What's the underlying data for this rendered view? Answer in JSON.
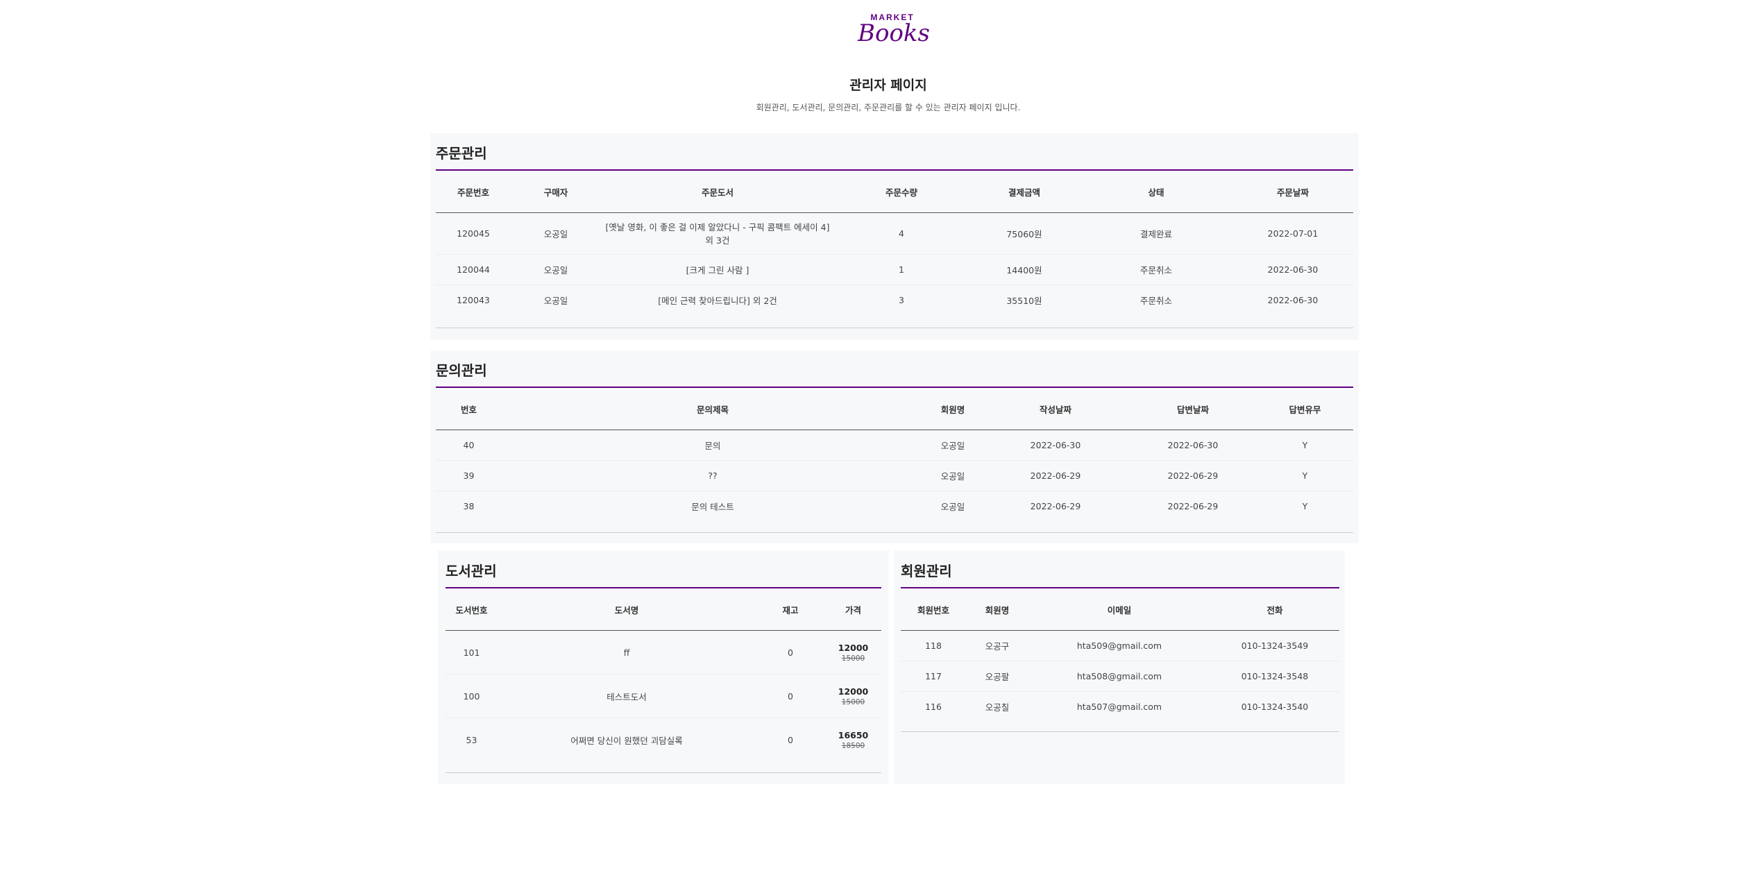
{
  "header": {
    "logo_top": "MARKET",
    "logo_main": "Books",
    "title": "관리자 페이지",
    "description": "회원관리, 도서관리, 문의관리, 주문관리를 할 수 있는 관리자 페이지 입니다."
  },
  "orders": {
    "title": "주문관리",
    "columns": [
      "주문번호",
      "구매자",
      "주문도서",
      "주문수량",
      "결제금액",
      "상태",
      "주문날짜"
    ],
    "rows": [
      [
        "120045",
        "오공일",
        "[옛날 영화, 이 좋은 걸 이제 알았다니 - 구픽 콤팩트 에세이 4] 외 3건",
        "4",
        "75060원",
        "결제완료",
        "2022-07-01"
      ],
      [
        "120044",
        "오공일",
        "[크게 그린 사람 ]",
        "1",
        "14400원",
        "주문취소",
        "2022-06-30"
      ],
      [
        "120043",
        "오공일",
        "[메인 근력 찾아드립니다] 외 2건",
        "3",
        "35510원",
        "주문취소",
        "2022-06-30"
      ]
    ]
  },
  "inquiries": {
    "title": "문의관리",
    "columns": [
      "번호",
      "문의제목",
      "회원명",
      "작성날짜",
      "답변날짜",
      "답변유무"
    ],
    "rows": [
      [
        "40",
        "문의",
        "오공일",
        "2022-06-30",
        "2022-06-30",
        "Y"
      ],
      [
        "39",
        "??",
        "오공일",
        "2022-06-29",
        "2022-06-29",
        "Y"
      ],
      [
        "38",
        "문의 테스트",
        "오공일",
        "2022-06-29",
        "2022-06-29",
        "Y"
      ]
    ]
  },
  "books": {
    "title": "도서관리",
    "columns": [
      "도서번호",
      "도서명",
      "재고",
      "가격"
    ],
    "rows": [
      {
        "id": "101",
        "name": "ff",
        "stock": "0",
        "price": "12000",
        "original_price": "15000"
      },
      {
        "id": "100",
        "name": "테스트도서",
        "stock": "0",
        "price": "12000",
        "original_price": "15000"
      },
      {
        "id": "53",
        "name": "어쩌면 당신이 원했던 괴담실록",
        "stock": "0",
        "price": "16650",
        "original_price": "18500"
      }
    ]
  },
  "members": {
    "title": "회원관리",
    "columns": [
      "회원번호",
      "회원명",
      "이메일",
      "전화"
    ],
    "rows": [
      [
        "118",
        "오공구",
        "hta509@gmail.com",
        "010-1324-3549"
      ],
      [
        "117",
        "오공팔",
        "hta508@gmail.com",
        "010-1324-3548"
      ],
      [
        "116",
        "오공칠",
        "hta507@gmail.com",
        "010-1324-3540"
      ]
    ]
  },
  "colors": {
    "accent": "#5f0080",
    "panel_bg": "#f7f8fa"
  }
}
